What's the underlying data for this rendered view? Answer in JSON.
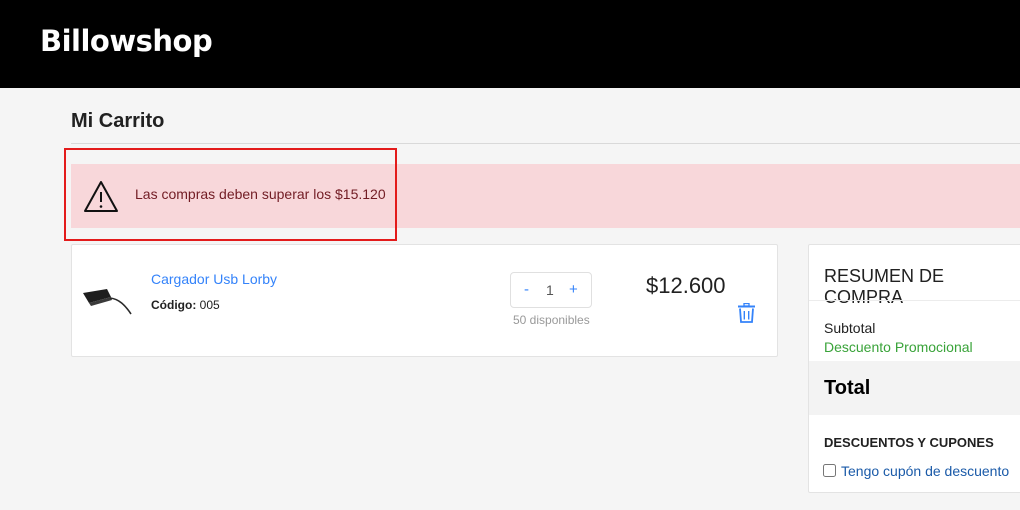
{
  "header": {
    "logo": "Billowshop"
  },
  "page": {
    "title": "Mi Carrito"
  },
  "alert": {
    "icon": "warning-icon",
    "message": "Las compras deben superar los $15.120"
  },
  "cart": {
    "items": [
      {
        "name": "Cargador Usb Lorby",
        "code_label": "Código:",
        "code": "005",
        "qty_minus": "-",
        "qty_value": "1",
        "qty_plus": "+",
        "stock": "50 disponibles",
        "price": "$12.600",
        "delete_icon": "trash-icon"
      }
    ]
  },
  "summary": {
    "title": "RESUMEN DE COMPRA",
    "subtotal_label": "Subtotal",
    "promo_label": "Descuento Promocional",
    "total_label": "Total",
    "discounts_title": "DESCUENTOS Y CUPONES",
    "coupon_label": "Tengo cupón de descuento",
    "coupon_checked": false
  },
  "colors": {
    "header_bg": "#000000",
    "link": "#3483fa",
    "alert_bg": "#f8d7da",
    "promo": "#39a339",
    "highlight": "#e31b1b"
  }
}
